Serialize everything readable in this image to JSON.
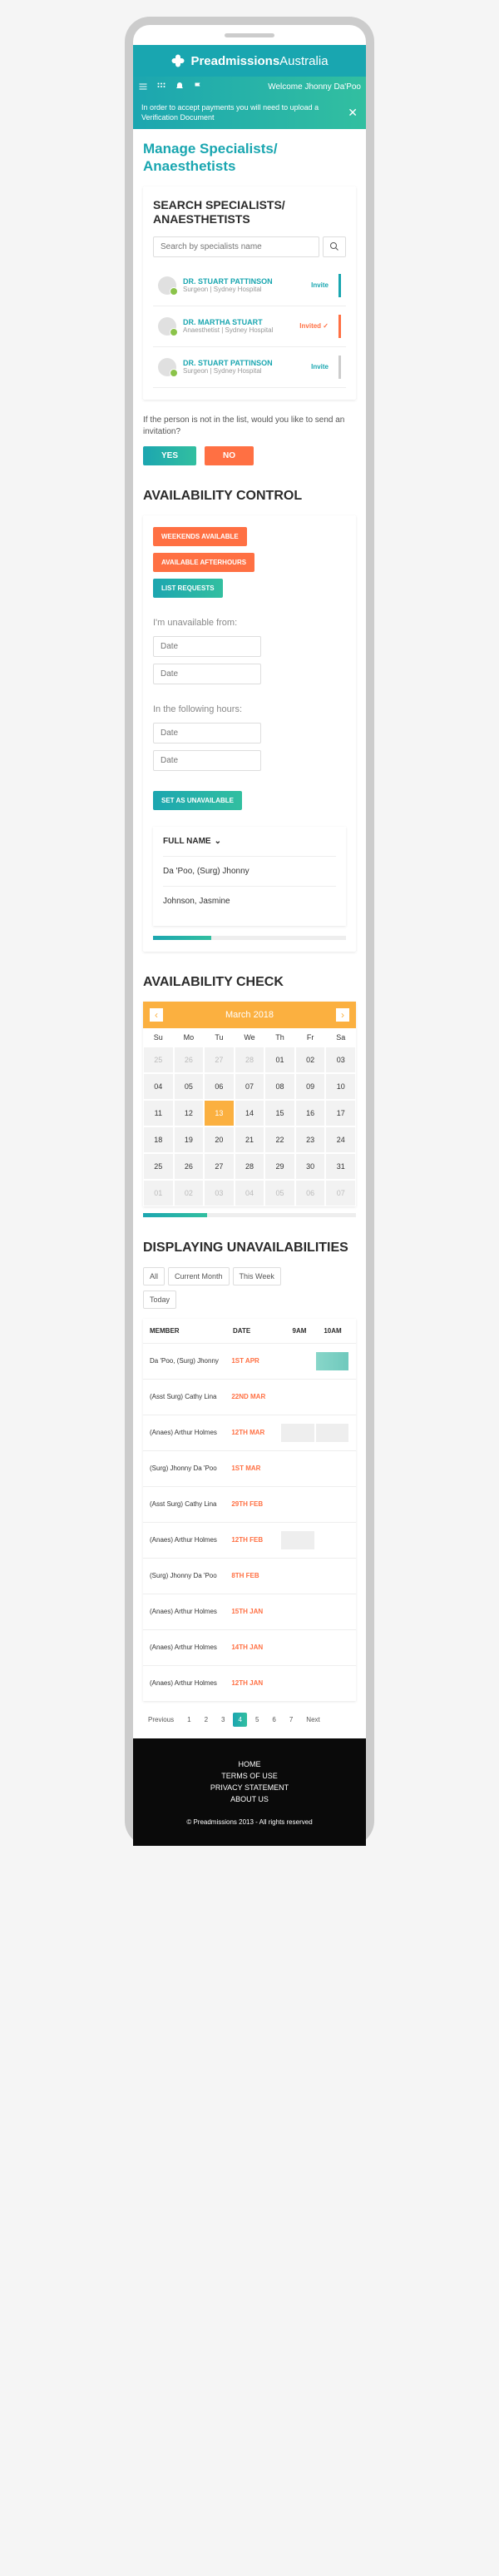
{
  "header": {
    "brand_a": "Preadmissions",
    "brand_b": "Australia"
  },
  "topbar": {
    "welcome": "Welcome Jhonny Da'Poo"
  },
  "alert": {
    "text": "In order to accept payments you will need to upload a Verification Document"
  },
  "page_title": "Manage Specialists/\nAnaesthetists",
  "search": {
    "heading": "SEARCH SPECIALISTS/ ANAESTHETISTS",
    "placeholder": "Search by specialists name",
    "results": [
      {
        "name": "DR. STUART PATTINSON",
        "sub": "Surgeon | Sydney Hospital",
        "action": "Invite",
        "invited": false,
        "bar": "teal"
      },
      {
        "name": "DR. MARTHA STUART",
        "sub": "Anaesthetist | Sydney Hospital",
        "action": "Invited ✓",
        "invited": true,
        "bar": "orange"
      },
      {
        "name": "DR. STUART PATTINSON",
        "sub": "Surgeon | Sydney Hospital",
        "action": "Invite",
        "invited": false,
        "bar": "grey"
      }
    ],
    "prompt": "If the person is not in the list, would you like to send an invitation?",
    "yes": "YES",
    "no": "NO"
  },
  "availability": {
    "heading": "AVAILABILITY CONTROL",
    "chips": [
      "WEEKENDS AVAILABLE",
      "AVAILABLE AFTERHOURS",
      "LIST REQUESTS"
    ],
    "unavail_from": "I'm unavailable from:",
    "following_hours": "In the following hours:",
    "date_placeholder": "Date",
    "set_btn": "SET AS UNAVAILABLE",
    "full_name": "FULL NAME",
    "names": [
      "Da 'Poo, (Surg) Jhonny",
      "Johnson, Jasmine"
    ]
  },
  "calendar": {
    "heading": "AVAILABILITY CHECK",
    "month": "March 2018",
    "dow": [
      "Su",
      "Mo",
      "Tu",
      "We",
      "Th",
      "Fr",
      "Sa"
    ],
    "weeks": [
      [
        {
          "n": "25",
          "p": true
        },
        {
          "n": "26",
          "p": true
        },
        {
          "n": "27",
          "p": true
        },
        {
          "n": "28",
          "p": true
        },
        {
          "n": "01"
        },
        {
          "n": "02"
        },
        {
          "n": "03"
        }
      ],
      [
        {
          "n": "04"
        },
        {
          "n": "05"
        },
        {
          "n": "06"
        },
        {
          "n": "07"
        },
        {
          "n": "08"
        },
        {
          "n": "09"
        },
        {
          "n": "10"
        }
      ],
      [
        {
          "n": "11"
        },
        {
          "n": "12"
        },
        {
          "n": "13",
          "sel": true
        },
        {
          "n": "14"
        },
        {
          "n": "15"
        },
        {
          "n": "16"
        },
        {
          "n": "17"
        }
      ],
      [
        {
          "n": "18"
        },
        {
          "n": "19"
        },
        {
          "n": "20"
        },
        {
          "n": "21"
        },
        {
          "n": "22"
        },
        {
          "n": "23"
        },
        {
          "n": "24"
        }
      ],
      [
        {
          "n": "25"
        },
        {
          "n": "26"
        },
        {
          "n": "27"
        },
        {
          "n": "28"
        },
        {
          "n": "29"
        },
        {
          "n": "30"
        },
        {
          "n": "31"
        }
      ],
      [
        {
          "n": "01",
          "x": true
        },
        {
          "n": "02",
          "x": true
        },
        {
          "n": "03",
          "x": true
        },
        {
          "n": "04",
          "x": true
        },
        {
          "n": "05",
          "x": true
        },
        {
          "n": "06",
          "x": true
        },
        {
          "n": "07",
          "x": true
        }
      ]
    ]
  },
  "unavail": {
    "heading": "DISPLAYING UNAVAILABILITIES",
    "filters": [
      "All",
      "Current Month",
      "This Week",
      "Today"
    ],
    "cols": {
      "member": "MEMBER",
      "date": "DATE",
      "t1": "9AM",
      "t2": "10AM"
    },
    "rows": [
      {
        "member": "Da 'Poo, (Surg) Jhonny",
        "date": "1ST APR",
        "slots": [
          "",
          "fill"
        ]
      },
      {
        "member": "(Asst Surg) Cathy Lina",
        "date": "22ND MAR",
        "slots": [
          "",
          ""
        ]
      },
      {
        "member": "(Anaes) Arthur Holmes",
        "date": "12TH MAR",
        "slots": [
          "gray",
          "gray"
        ]
      },
      {
        "member": "(Surg) Jhonny Da 'Poo",
        "date": "1ST MAR",
        "slots": [
          "",
          ""
        ]
      },
      {
        "member": "(Asst Surg) Cathy Lina",
        "date": "29TH FEB",
        "slots": [
          "",
          ""
        ]
      },
      {
        "member": "(Anaes) Arthur Holmes",
        "date": "12TH FEB",
        "slots": [
          "gray",
          ""
        ]
      },
      {
        "member": "(Surg) Jhonny Da 'Poo",
        "date": "8TH FEB",
        "slots": [
          "",
          ""
        ]
      },
      {
        "member": "(Anaes) Arthur Holmes",
        "date": "15TH JAN",
        "slots": [
          "",
          ""
        ]
      },
      {
        "member": "(Anaes) Arthur Holmes",
        "date": "14TH JAN",
        "slots": [
          "",
          ""
        ]
      },
      {
        "member": "(Anaes) Arthur Holmes",
        "date": "12TH JAN",
        "slots": [
          "",
          ""
        ]
      }
    ],
    "pagination": {
      "prev": "Previous",
      "next": "Next",
      "pages": [
        "1",
        "2",
        "3",
        "4",
        "5",
        "6",
        "7"
      ],
      "active": "4"
    }
  },
  "footer": {
    "links": [
      "HOME",
      "TERMS OF USE",
      "PRIVACY STATEMENT",
      "ABOUT US"
    ],
    "copy": "© Preadmissions 2013 - All rights reserved"
  }
}
